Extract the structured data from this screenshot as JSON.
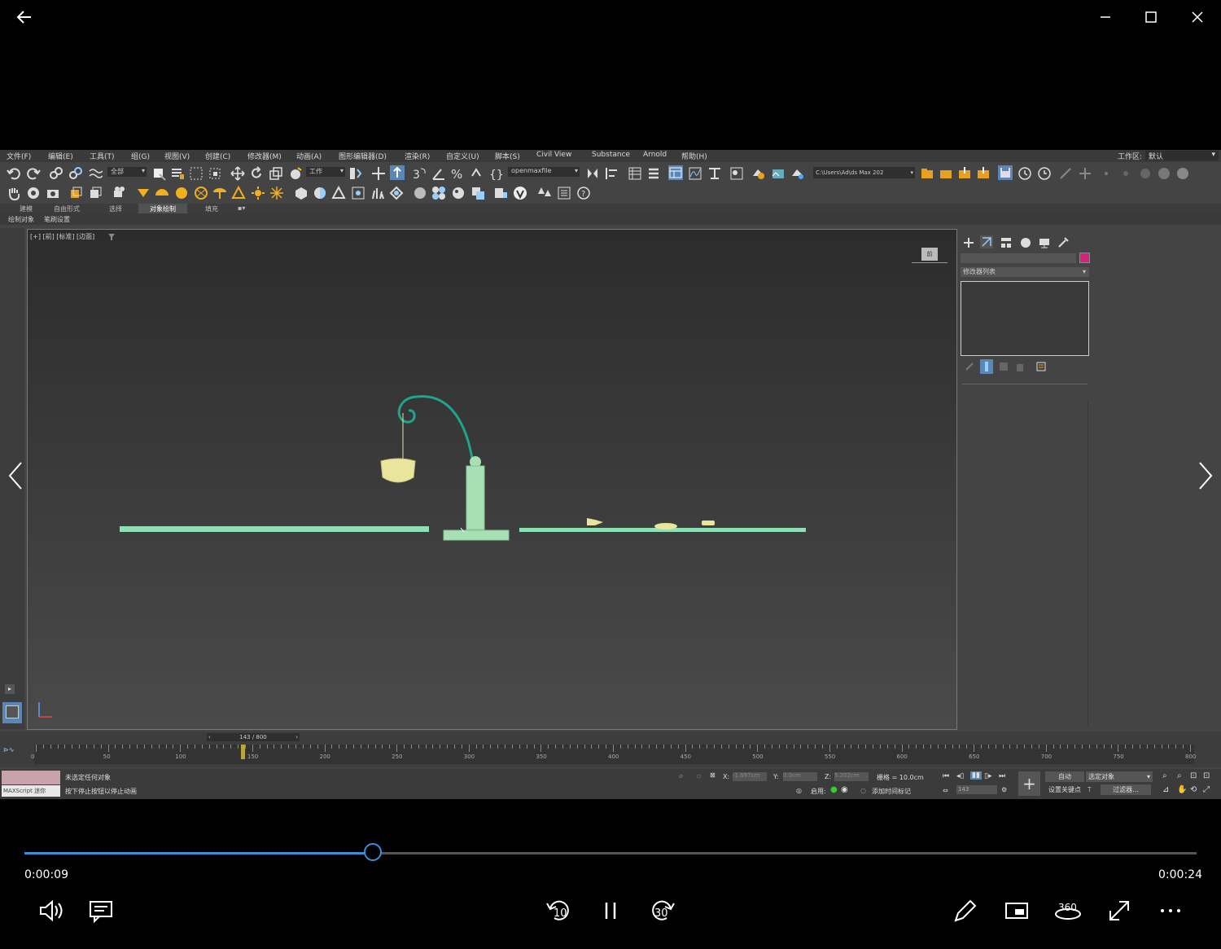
{
  "window": {
    "back_icon": "arrow-left-icon",
    "minimize_icon": "minimize-icon",
    "maximize_icon": "maximize-icon",
    "close_icon": "close-icon"
  },
  "app": {
    "menu": [
      "文件(F)",
      "编辑(E)",
      "工具(T)",
      "组(G)",
      "视图(V)",
      "创建(C)",
      "修改器(M)",
      "动画(A)",
      "图形编辑器(D)",
      "渲染(R)",
      "自定义(U)",
      "脚本(S)",
      "Civil View",
      "Substance",
      "Arnold",
      "帮助(H)"
    ],
    "workspace_label": "工作区:",
    "workspace_value": "默认",
    "selection_filter": "全部",
    "coord_system": "工作",
    "named_selection": "openmaxfile",
    "project_path": "C:\\Users\\Ad\\ds Max 202",
    "ribbon_tabs": [
      "建模",
      "自由形式",
      "选择",
      "对象绘制",
      "填充"
    ],
    "ribbon_active": "对象绘制",
    "ribbon_sub": [
      "绘制对象",
      "笔刷设置"
    ],
    "viewport_label": "[+] [前] [标准] [边面]",
    "viewcube_label": "前",
    "modifier_list": "修改器列表",
    "object_color": "#d4237a",
    "frame_indicator": "143 / 800",
    "timeline_ticks": [
      "0",
      "50",
      "100",
      "150",
      "200",
      "250",
      "300",
      "350",
      "400",
      "450",
      "500",
      "550",
      "600",
      "650",
      "700",
      "750",
      "800"
    ],
    "status_line1": "未选定任何对象",
    "status_line2": "按下停止按钮以停止动画",
    "maxscript_label": "MAXScript 迷你",
    "coord_x_label": "X:",
    "coord_x": "-1.697cm",
    "coord_y_label": "Y:",
    "coord_y": "0.0cm",
    "coord_z_label": "Z:",
    "coord_z": "5.202cm",
    "grid_label": "栅格 = 10.0cm",
    "enable_label": "启用:",
    "add_time_tag": "添加时间标记",
    "auto_key": "自动",
    "set_key": "设置关键点",
    "selected_object": "选定对象",
    "filters": "过滤器...",
    "current_frame": "143"
  },
  "player": {
    "elapsed": "0:00:09",
    "total": "0:00:24",
    "progress": 0.297,
    "volume_icon": "volume-icon",
    "subtitles_icon": "subtitles-icon",
    "rewind_label": "10",
    "forward_label": "30",
    "pause_icon": "pause-icon",
    "edit_icon": "pen-icon",
    "miniview_icon": "mini-view-icon",
    "three_sixty_label": "360",
    "fullscreen_icon": "fullscreen-icon",
    "more_icon": "more-icon",
    "prev_icon": "chevron-left-icon",
    "next_icon": "chevron-right-icon"
  }
}
